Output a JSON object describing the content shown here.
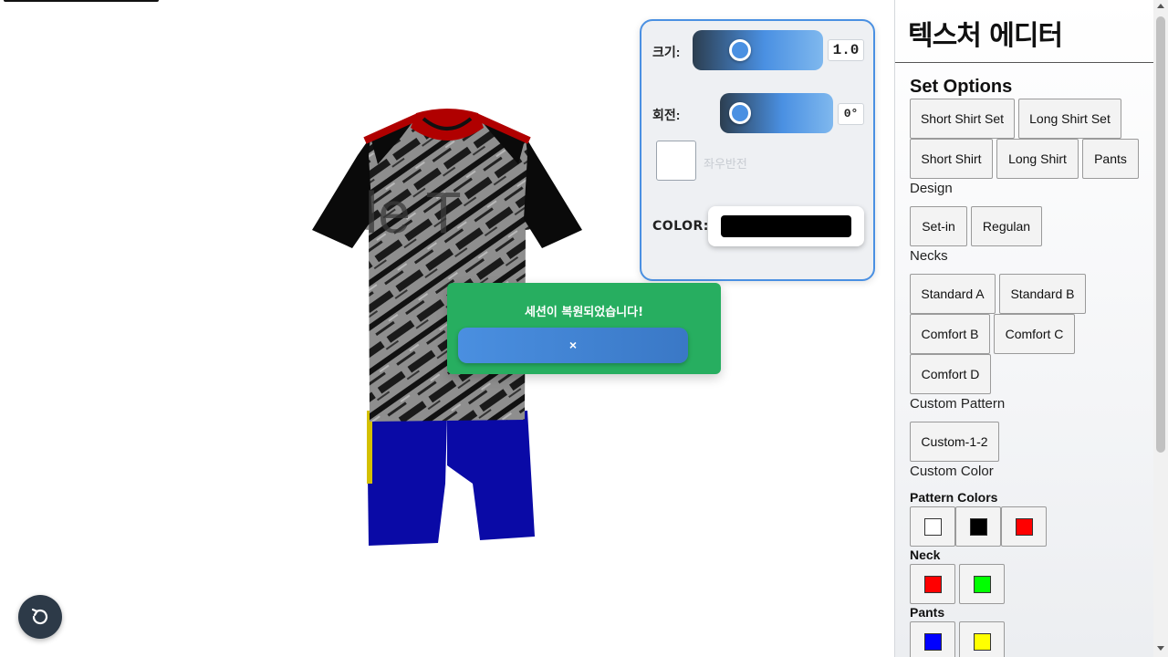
{
  "canvas": {
    "shirt_overlay_text": "le T"
  },
  "controls": {
    "size_label": "크기:",
    "size_value": "1.0",
    "rotation_label": "회전:",
    "rotation_value": "0°",
    "flip_label": "좌우반전",
    "color_label": "COLOR:",
    "color_value": "#000000"
  },
  "toast": {
    "message": "세션이 복원되었습니다!",
    "close_label": "×"
  },
  "sidebar": {
    "title": "텍스처 에디터",
    "set_options_heading": "Set Options",
    "set_options": [
      "Short Shirt Set",
      "Long Shirt Set",
      "Short Shirt",
      "Long Shirt",
      "Pants"
    ],
    "design_heading": "Design",
    "design": [
      "Set-in",
      "Regulan"
    ],
    "necks_heading": "Necks",
    "necks": [
      "Standard A",
      "Standard B",
      "Comfort B",
      "Comfort C",
      "Comfort D"
    ],
    "custom_pattern_heading": "Custom Pattern",
    "custom_pattern": [
      "Custom-1-2"
    ],
    "custom_color_heading": "Custom Color",
    "pattern_colors_heading": "Pattern Colors",
    "pattern_colors": [
      "#ffffff",
      "#000000",
      "#ff0000"
    ],
    "neck_colors_heading": "Neck",
    "neck_colors": [
      "#ff0000",
      "#00ff00"
    ],
    "pants_colors_heading": "Pants",
    "pants_colors": [
      "#0000ff",
      "#ffff00"
    ]
  },
  "icons": {
    "reset": "rotate-ccw-icon"
  }
}
